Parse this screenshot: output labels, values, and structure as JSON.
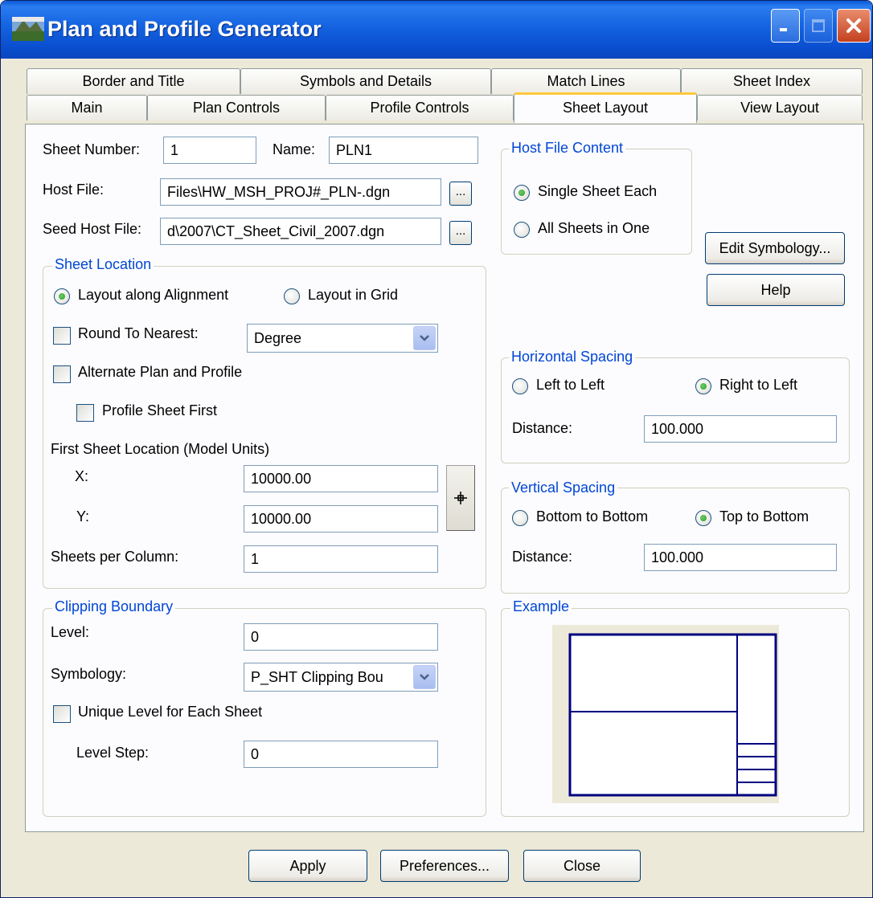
{
  "window": {
    "title": "Plan and Profile Generator"
  },
  "tabs_back": [
    "Border and Title",
    "Symbols and Details",
    "Match Lines",
    "Sheet Index"
  ],
  "tabs_front": [
    "Main",
    "Plan Controls",
    "Profile Controls",
    "Sheet Layout",
    "View Layout"
  ],
  "active_tab": "Sheet Layout",
  "sheet": {
    "number_label": "Sheet Number:",
    "number_value": "1",
    "name_label": "Name:",
    "name_value": "PLN1",
    "host_file_label": "Host File:",
    "host_file_value": "Files\\HW_MSH_PROJ#_PLN-.dgn",
    "seed_host_file_label": "Seed Host File:",
    "seed_host_file_value": "d\\2007\\CT_Sheet_Civil_2007.dgn",
    "browse_label": "..."
  },
  "sheet_location": {
    "title": "Sheet Location",
    "layout_along_alignment": "Layout along Alignment",
    "layout_in_grid": "Layout in Grid",
    "round_to_nearest": "Round To Nearest:",
    "round_value": "Degree",
    "alternate_plan_profile": "Alternate Plan and Profile",
    "profile_sheet_first": "Profile Sheet First",
    "first_sheet_location": "First Sheet Location (Model Units)",
    "x_label": "X:",
    "x_value": "10000.00",
    "y_label": "Y:",
    "y_value": "10000.00",
    "sheets_per_column_label": "Sheets per Column:",
    "sheets_per_column_value": "1"
  },
  "clipping": {
    "title": "Clipping Boundary",
    "level_label": "Level:",
    "level_value": "0",
    "symbology_label": "Symbology:",
    "symbology_value": "P_SHT Clipping Bou",
    "unique_level": "Unique Level for Each Sheet",
    "level_step_label": "Level Step:",
    "level_step_value": "0"
  },
  "host_file_content": {
    "title": "Host File Content",
    "single_sheet": "Single Sheet Each",
    "all_sheets": "All Sheets in One"
  },
  "buttons": {
    "edit_symbology": "Edit Symbology...",
    "help": "Help",
    "apply": "Apply",
    "preferences": "Preferences...",
    "close": "Close"
  },
  "horizontal_spacing": {
    "title": "Horizontal Spacing",
    "left_to_left": "Left to Left",
    "right_to_left": "Right to Left",
    "distance_label": "Distance:",
    "distance_value": "100.000"
  },
  "vertical_spacing": {
    "title": "Vertical Spacing",
    "bottom_to_bottom": "Bottom to Bottom",
    "top_to_bottom": "Top to Bottom",
    "distance_label": "Distance:",
    "distance_value": "100.000"
  },
  "example": {
    "title": "Example"
  },
  "colors": {
    "title_bar": "#0a4fd0",
    "group_title": "#0046d5",
    "active_tab_accent": "#ffc83c",
    "example_stroke": "#000080"
  }
}
